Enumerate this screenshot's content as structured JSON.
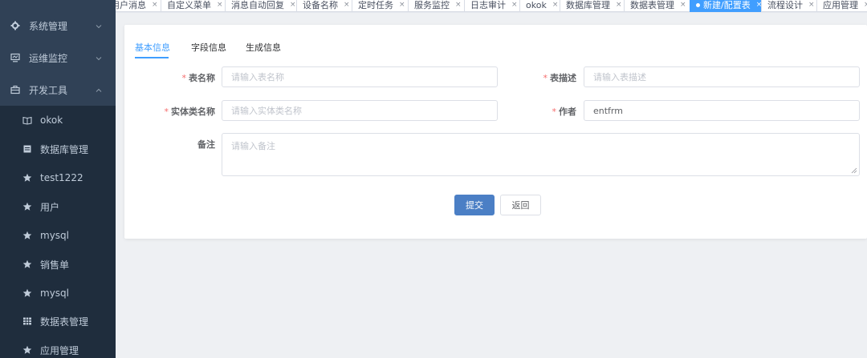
{
  "sidebar": {
    "items": [
      {
        "label": "系统管理",
        "icon": "gear-icon"
      },
      {
        "label": "运维监控",
        "icon": "monitor-icon"
      },
      {
        "label": "开发工具",
        "icon": "toolbox-icon"
      },
      {
        "label": "okok",
        "icon": "book-icon"
      },
      {
        "label": "数据库管理",
        "icon": "database-icon"
      },
      {
        "label": "test1222",
        "icon": "star-icon"
      },
      {
        "label": "用户",
        "icon": "star-icon"
      },
      {
        "label": "mysql",
        "icon": "star-icon"
      },
      {
        "label": "销售单",
        "icon": "star-icon"
      },
      {
        "label": "mysql",
        "icon": "star-icon"
      },
      {
        "label": "数据表管理",
        "icon": "table-icon"
      },
      {
        "label": "应用管理",
        "icon": "star-icon"
      }
    ]
  },
  "tabs": [
    {
      "label": "用户消息"
    },
    {
      "label": "自定义菜单"
    },
    {
      "label": "消息自动回复"
    },
    {
      "label": "设备名称"
    },
    {
      "label": "定时任务"
    },
    {
      "label": "服务监控"
    },
    {
      "label": "日志审计"
    },
    {
      "label": "okok"
    },
    {
      "label": "数据库管理"
    },
    {
      "label": "数据表管理"
    },
    {
      "label": "新建/配置表",
      "active": true
    },
    {
      "label": "流程设计"
    },
    {
      "label": "应用管理"
    }
  ],
  "tab_close": "×",
  "subtabs": [
    "基本信息",
    "字段信息",
    "生成信息"
  ],
  "form": {
    "required_mark": "*",
    "table_name": {
      "label": "表名称",
      "placeholder": "请输入表名称",
      "value": ""
    },
    "table_desc": {
      "label": "表描述",
      "placeholder": "请输入表描述",
      "value": ""
    },
    "entity_name": {
      "label": "实体类名称",
      "placeholder": "请输入实体类名称",
      "value": ""
    },
    "author": {
      "label": "作者",
      "value": "entfrm"
    },
    "remark": {
      "label": "备注",
      "placeholder": "请输入备注",
      "value": ""
    }
  },
  "buttons": {
    "submit": "提交",
    "back": "返回"
  },
  "colors": {
    "sidebar_bg": "#304156",
    "primary": "#409eff",
    "submit": "#4b7fc5",
    "required": "#f56c6c"
  }
}
